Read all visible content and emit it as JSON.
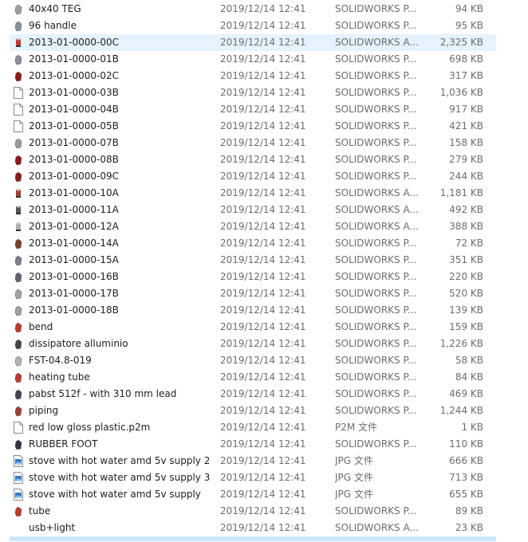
{
  "files": [
    {
      "name": "40x40 TEG",
      "date": "2019/12/14 12:41",
      "type": "SOLIDWORKS P...",
      "size": "94 KB",
      "icon": "part-icon",
      "color": "#9aa0a8"
    },
    {
      "name": "96 handle",
      "date": "2019/12/14 12:41",
      "type": "SOLIDWORKS P...",
      "size": "95 KB",
      "icon": "part-icon",
      "color": "#8a9098"
    },
    {
      "name": "2013-01-0000-00C",
      "date": "2019/12/14 12:41",
      "type": "SOLIDWORKS A...",
      "size": "2,325 KB",
      "icon": "assembly-icon",
      "color": "#c0392b"
    },
    {
      "name": "2013-01-0000-01B",
      "date": "2019/12/14 12:41",
      "type": "SOLIDWORKS P...",
      "size": "698 KB",
      "icon": "part-icon",
      "color": "#8a8f98"
    },
    {
      "name": "2013-01-0000-02C",
      "date": "2019/12/14 12:41",
      "type": "SOLIDWORKS P...",
      "size": "317 KB",
      "icon": "part-icon",
      "color": "#8b1a1a"
    },
    {
      "name": "2013-01-0000-03B",
      "date": "2019/12/14 12:41",
      "type": "SOLIDWORKS P...",
      "size": "1,036 KB",
      "icon": "blank-file-icon",
      "color": "#ffffff"
    },
    {
      "name": "2013-01-0000-04B",
      "date": "2019/12/14 12:41",
      "type": "SOLIDWORKS P...",
      "size": "917 KB",
      "icon": "blank-file-icon",
      "color": "#ffffff"
    },
    {
      "name": "2013-01-0000-05B",
      "date": "2019/12/14 12:41",
      "type": "SOLIDWORKS P...",
      "size": "421 KB",
      "icon": "blank-file-icon",
      "color": "#ffffff"
    },
    {
      "name": "2013-01-0000-07B",
      "date": "2019/12/14 12:41",
      "type": "SOLIDWORKS P...",
      "size": "158 KB",
      "icon": "part-icon",
      "color": "#9a9aa0"
    },
    {
      "name": "2013-01-0000-08B",
      "date": "2019/12/14 12:41",
      "type": "SOLIDWORKS P...",
      "size": "279 KB",
      "icon": "part-icon",
      "color": "#8b1a1a"
    },
    {
      "name": "2013-01-0000-09C",
      "date": "2019/12/14 12:41",
      "type": "SOLIDWORKS P...",
      "size": "244 KB",
      "icon": "part-icon",
      "color": "#8b1a1a"
    },
    {
      "name": "2013-01-0000-10A",
      "date": "2019/12/14 12:41",
      "type": "SOLIDWORKS A...",
      "size": "1,181 KB",
      "icon": "assembly-icon",
      "color": "#a04030"
    },
    {
      "name": "2013-01-0000-11A",
      "date": "2019/12/14 12:41",
      "type": "SOLIDWORKS A...",
      "size": "492 KB",
      "icon": "assembly-icon",
      "color": "#505560"
    },
    {
      "name": "2013-01-0000-12A",
      "date": "2019/12/14 12:41",
      "type": "SOLIDWORKS A...",
      "size": "388 KB",
      "icon": "assembly-icon",
      "color": "#b0b0b8"
    },
    {
      "name": "2013-01-0000-14A",
      "date": "2019/12/14 12:41",
      "type": "SOLIDWORKS P...",
      "size": "72 KB",
      "icon": "part-icon",
      "color": "#7a4030"
    },
    {
      "name": "2013-01-0000-15A",
      "date": "2019/12/14 12:41",
      "type": "SOLIDWORKS P...",
      "size": "351 KB",
      "icon": "part-icon",
      "color": "#7a7f88"
    },
    {
      "name": "2013-01-0000-16B",
      "date": "2019/12/14 12:41",
      "type": "SOLIDWORKS P...",
      "size": "220 KB",
      "icon": "part-icon",
      "color": "#606570"
    },
    {
      "name": "2013-01-0000-17B",
      "date": "2019/12/14 12:41",
      "type": "SOLIDWORKS P...",
      "size": "520 KB",
      "icon": "part-icon",
      "color": "#a0a0a8"
    },
    {
      "name": "2013-01-0000-18B",
      "date": "2019/12/14 12:41",
      "type": "SOLIDWORKS P...",
      "size": "139 KB",
      "icon": "part-icon",
      "color": "#9aa0a8"
    },
    {
      "name": "bend",
      "date": "2019/12/14 12:41",
      "type": "SOLIDWORKS P...",
      "size": "159 KB",
      "icon": "part-icon",
      "color": "#c0392b"
    },
    {
      "name": "dissipatore alluminio",
      "date": "2019/12/14 12:41",
      "type": "SOLIDWORKS P...",
      "size": "1,226 KB",
      "icon": "part-icon",
      "color": "#404550"
    },
    {
      "name": "FST-04.8-019",
      "date": "2019/12/14 12:41",
      "type": "SOLIDWORKS P...",
      "size": "58 KB",
      "icon": "part-icon",
      "color": "#b0b4ba"
    },
    {
      "name": "heating tube",
      "date": "2019/12/14 12:41",
      "type": "SOLIDWORKS P...",
      "size": "84 KB",
      "icon": "part-icon",
      "color": "#c0392b"
    },
    {
      "name": "pabst 512f - with 310 mm lead",
      "date": "2019/12/14 12:41",
      "type": "SOLIDWORKS P...",
      "size": "469 KB",
      "icon": "part-icon",
      "color": "#404550"
    },
    {
      "name": "piping",
      "date": "2019/12/14 12:41",
      "type": "SOLIDWORKS P...",
      "size": "1,244 KB",
      "icon": "part-icon",
      "color": "#a04030"
    },
    {
      "name": "red low gloss plastic.p2m",
      "date": "2019/12/14 12:41",
      "type": "P2M 文件",
      "size": "1 KB",
      "icon": "blank-file-icon",
      "color": "#ffffff"
    },
    {
      "name": "RUBBER FOOT",
      "date": "2019/12/14 12:41",
      "type": "SOLIDWORKS P...",
      "size": "110 KB",
      "icon": "part-icon",
      "color": "#303540"
    },
    {
      "name": "stove with hot water amd 5v supply 2",
      "date": "2019/12/14 12:41",
      "type": "JPG 文件",
      "size": "666 KB",
      "icon": "image-file-icon",
      "color": "#3a78c8"
    },
    {
      "name": "stove with hot water amd 5v supply 3",
      "date": "2019/12/14 12:41",
      "type": "JPG 文件",
      "size": "713 KB",
      "icon": "image-file-icon",
      "color": "#3a78c8"
    },
    {
      "name": "stove with hot water amd 5v supply",
      "date": "2019/12/14 12:41",
      "type": "JPG 文件",
      "size": "655 KB",
      "icon": "image-file-icon",
      "color": "#3a78c8"
    },
    {
      "name": "tube",
      "date": "2019/12/14 12:41",
      "type": "SOLIDWORKS P...",
      "size": "89 KB",
      "icon": "part-icon",
      "color": "#c0392b"
    },
    {
      "name": "usb+light",
      "date": "2019/12/14 12:41",
      "type": "SOLIDWORKS A...",
      "size": "23 KB",
      "icon": "blank-icon",
      "color": "#ffffff"
    }
  ],
  "selected_index": 2,
  "selection_color": "#e5f3ff"
}
